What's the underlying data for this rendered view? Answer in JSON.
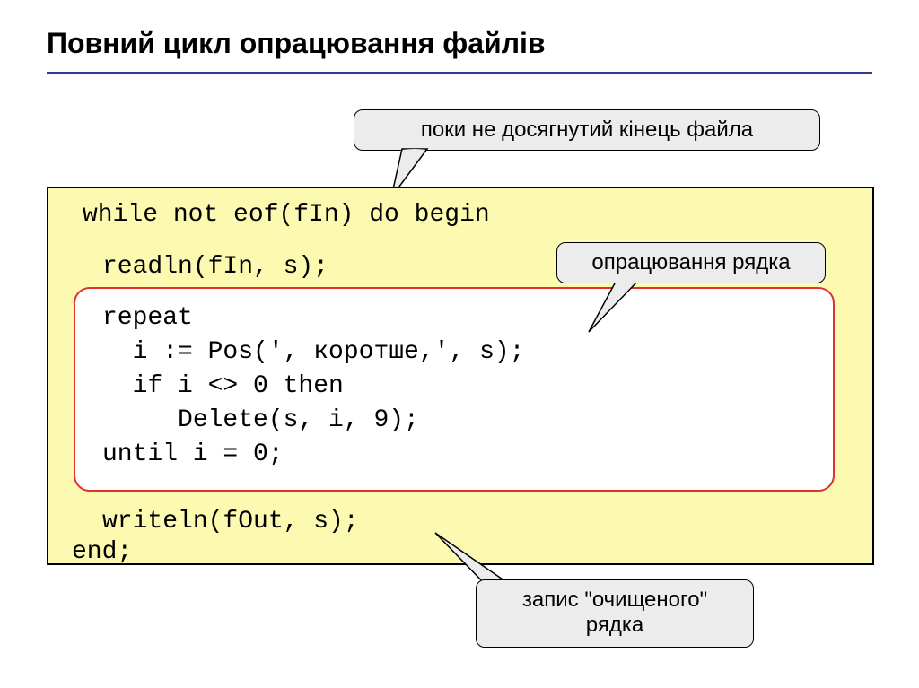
{
  "title": "Повний цикл опрацювання файлів",
  "callouts": {
    "top": "поки не досягнутий кінець файла",
    "middle": "опрацювання рядка",
    "bottom": "запис \"очищеного\" рядка"
  },
  "code": {
    "line1": "while not eof(fIn) do begin",
    "line2": "readln(fIn, s);",
    "inner": "repeat\n  i := Pos(', коротше,', s);\n  if i <> 0 then\n     Delete(s, i, 9);\nuntil i = 0;",
    "line3": "writeln(fOut, s);",
    "line4": "end;"
  }
}
